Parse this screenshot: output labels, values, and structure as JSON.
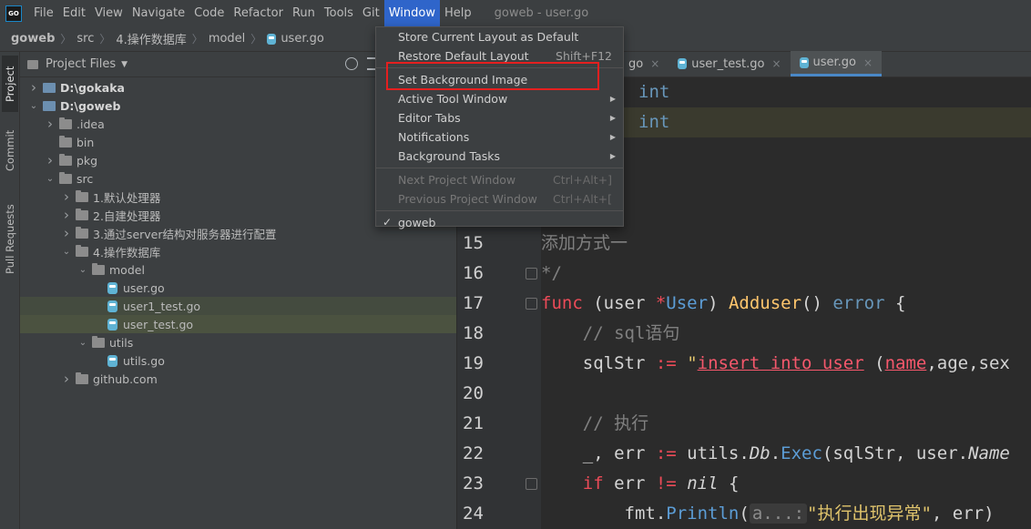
{
  "app": {
    "logo": "GO",
    "window_title": "goweb - user.go"
  },
  "menubar": {
    "items": [
      "File",
      "Edit",
      "View",
      "Navigate",
      "Code",
      "Refactor",
      "Run",
      "Tools",
      "Git",
      "Window",
      "Help"
    ],
    "active": "Window"
  },
  "breadcrumb": {
    "items": [
      "goweb",
      "src",
      "4.操作数据库",
      "model",
      "user.go"
    ]
  },
  "tool_strip": {
    "tabs": [
      "Project",
      "Commit",
      "Pull Requests"
    ]
  },
  "project_panel": {
    "title": "Project Files",
    "tree": [
      {
        "label": "D:\\gokaka",
        "depth": 0,
        "kind": "module",
        "chevron": "right",
        "bold": true
      },
      {
        "label": "D:\\goweb",
        "depth": 0,
        "kind": "module",
        "chevron": "down",
        "bold": true
      },
      {
        "label": ".idea",
        "depth": 1,
        "kind": "folder",
        "chevron": "right"
      },
      {
        "label": "bin",
        "depth": 1,
        "kind": "folder",
        "chevron": ""
      },
      {
        "label": "pkg",
        "depth": 1,
        "kind": "folder",
        "chevron": "right"
      },
      {
        "label": "src",
        "depth": 1,
        "kind": "folder",
        "chevron": "down"
      },
      {
        "label": "1.默认处理器",
        "depth": 2,
        "kind": "folder",
        "chevron": "right"
      },
      {
        "label": "2.自建处理器",
        "depth": 2,
        "kind": "folder",
        "chevron": "right"
      },
      {
        "label": "3.通过server结构对服务器进行配置",
        "depth": 2,
        "kind": "folder",
        "chevron": "right"
      },
      {
        "label": "4.操作数据库",
        "depth": 2,
        "kind": "folder",
        "chevron": "down"
      },
      {
        "label": "model",
        "depth": 3,
        "kind": "folder",
        "chevron": "down"
      },
      {
        "label": "user.go",
        "depth": 4,
        "kind": "gofile",
        "chevron": ""
      },
      {
        "label": "user1_test.go",
        "depth": 4,
        "kind": "gofile",
        "chevron": "",
        "state": "highlight"
      },
      {
        "label": "user_test.go",
        "depth": 4,
        "kind": "gofile",
        "chevron": "",
        "state": "selected"
      },
      {
        "label": "utils",
        "depth": 3,
        "kind": "folder",
        "chevron": "down"
      },
      {
        "label": "utils.go",
        "depth": 4,
        "kind": "gofile",
        "chevron": ""
      },
      {
        "label": "github.com",
        "depth": 2,
        "kind": "folder",
        "chevron": "right"
      }
    ]
  },
  "editor_tabs": [
    {
      "label": "go",
      "active": false,
      "close": "×"
    },
    {
      "label": "user_test.go",
      "active": false,
      "close": "×"
    },
    {
      "label": "user.go",
      "active": true,
      "close": "×"
    }
  ],
  "window_menu": {
    "items": [
      {
        "label": "Store Current Layout as Default",
        "shortcut": "",
        "submenu": false,
        "disabled": false
      },
      {
        "label": "Restore Default Layout",
        "shortcut": "Shift+F12",
        "submenu": false,
        "disabled": false
      },
      {
        "separator": true
      },
      {
        "label": "Set Background Image",
        "shortcut": "",
        "submenu": false,
        "disabled": false,
        "highlighted": true
      },
      {
        "label": "Active Tool Window",
        "shortcut": "",
        "submenu": true,
        "disabled": false
      },
      {
        "label": "Editor Tabs",
        "shortcut": "",
        "submenu": true,
        "disabled": false
      },
      {
        "label": "Notifications",
        "shortcut": "",
        "submenu": true,
        "disabled": false
      },
      {
        "label": "Background Tasks",
        "shortcut": "",
        "submenu": true,
        "disabled": false
      },
      {
        "separator": true
      },
      {
        "label": "Next Project Window",
        "shortcut": "Ctrl+Alt+]",
        "submenu": false,
        "disabled": true
      },
      {
        "label": "Previous Project Window",
        "shortcut": "Ctrl+Alt+[",
        "submenu": false,
        "disabled": true
      },
      {
        "separator": true
      },
      {
        "label": "goweb",
        "shortcut": "",
        "submenu": false,
        "disabled": false,
        "checked": true
      }
    ]
  },
  "editor": {
    "top_lines": [
      {
        "text": "int",
        "highlight": false
      },
      {
        "text": "int",
        "highlight": true
      }
    ],
    "lines": [
      {
        "num": "15",
        "tokens": [
          [
            "cm",
            "添加方式一"
          ]
        ]
      },
      {
        "num": "16",
        "tokens": [
          [
            "cm",
            "*/"
          ]
        ],
        "fold": true
      },
      {
        "num": "17",
        "tokens": [
          [
            "kw-red",
            "func"
          ],
          [
            "plain",
            " (user "
          ],
          [
            "kw-red",
            "*"
          ],
          [
            "ty2",
            "User"
          ],
          [
            "plain",
            ") "
          ],
          [
            "fn",
            "Adduser"
          ],
          [
            "plain",
            "() "
          ],
          [
            "ty",
            "error"
          ],
          [
            "plain",
            " {"
          ]
        ],
        "fold": true
      },
      {
        "num": "18",
        "tokens": [
          [
            "plain",
            "    "
          ],
          [
            "cm",
            "// sql语句"
          ]
        ]
      },
      {
        "num": "19",
        "tokens": [
          [
            "plain",
            "    sqlStr "
          ],
          [
            "kw-red",
            ":="
          ],
          [
            "plain",
            " "
          ],
          [
            "str2",
            "\""
          ],
          [
            "sql-under",
            "insert into user"
          ],
          [
            "plain",
            " ("
          ],
          [
            "sql-under",
            "name"
          ],
          [
            "plain",
            ",age,sex"
          ]
        ]
      },
      {
        "num": "20",
        "tokens": []
      },
      {
        "num": "21",
        "tokens": [
          [
            "plain",
            "    "
          ],
          [
            "cm",
            "// 执行"
          ]
        ]
      },
      {
        "num": "22",
        "tokens": [
          [
            "plain",
            "    _, err "
          ],
          [
            "kw-red",
            ":="
          ],
          [
            "plain",
            " utils."
          ],
          [
            "it",
            "Db"
          ],
          [
            "plain",
            "."
          ],
          [
            "ty2",
            "Exec"
          ],
          [
            "plain",
            "(sqlStr, user."
          ],
          [
            "it",
            "Name"
          ]
        ]
      },
      {
        "num": "23",
        "tokens": [
          [
            "plain",
            "    "
          ],
          [
            "kw-red",
            "if"
          ],
          [
            "plain",
            " err "
          ],
          [
            "kw-red",
            "!="
          ],
          [
            "plain",
            " "
          ],
          [
            "it",
            "nil"
          ],
          [
            "plain",
            " {"
          ]
        ],
        "fold": true
      },
      {
        "num": "24",
        "tokens": [
          [
            "plain",
            "        fmt."
          ],
          [
            "ty2",
            "Println"
          ],
          [
            "plain",
            "("
          ],
          [
            "hint-bg",
            "a...:"
          ],
          [
            "str2",
            "\"执行出现异常\""
          ],
          [
            "plain",
            ", err)"
          ]
        ]
      }
    ]
  },
  "colors": {
    "menu_active": "#2f65ca",
    "highlight_box": "#e51f1f",
    "editor_bg": "#2b2b2b",
    "panel_bg": "#3c3f41"
  }
}
